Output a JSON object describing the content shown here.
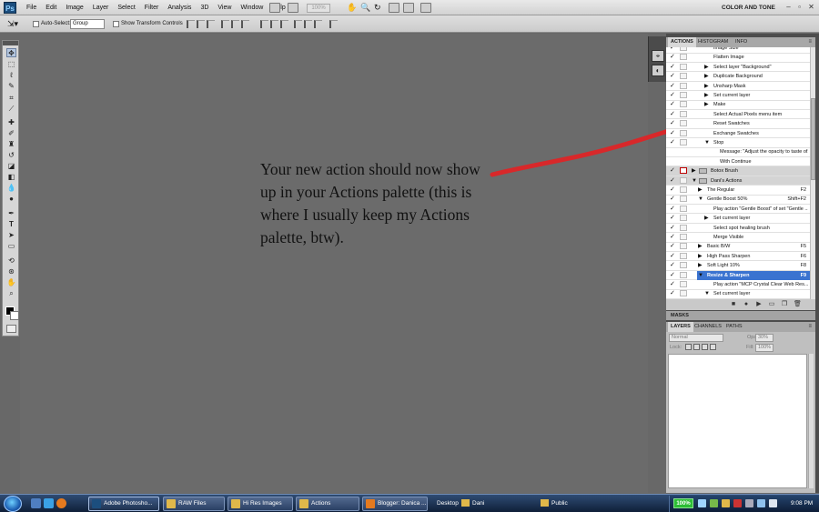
{
  "app": {
    "logo": "Ps",
    "workspace": "COLOR AND TONE",
    "zoom": "100%"
  },
  "menu": [
    "File",
    "Edit",
    "Image",
    "Layer",
    "Select",
    "Filter",
    "Analysis",
    "3D",
    "View",
    "Window",
    "Help"
  ],
  "options": {
    "auto_select_label": "Auto-Select:",
    "auto_select_value": "Group",
    "transform_label": "Show Transform Controls"
  },
  "caption": "Your new action should now show up in your Actions palette (this is where I usually keep my Actions palette, btw).",
  "panels": {
    "top_tabs": [
      "ACTIONS",
      "HISTOGRAM",
      "INFO"
    ],
    "masks_tab": "MASKS",
    "layers_tabs": [
      "LAYERS",
      "CHANNELS",
      "PATHS"
    ],
    "layers": {
      "blend_mode": "Normal",
      "opacity_label": "Opacity:",
      "opacity_value": "30%",
      "lock_label": "Lock:",
      "fill_label": "Fill:",
      "fill_value": "100%"
    }
  },
  "actions": [
    {
      "label": "Image Size",
      "indent": 3,
      "tri": "",
      "check": "✓",
      "dialog": "off",
      "key": ""
    },
    {
      "label": "Flatten Image",
      "indent": 3,
      "tri": "",
      "check": "✓",
      "dialog": "off",
      "key": ""
    },
    {
      "label": "Select layer \"Background\"",
      "indent": 3,
      "tri": "▶",
      "check": "✓",
      "dialog": "off",
      "key": ""
    },
    {
      "label": "Duplicate Background",
      "indent": 3,
      "tri": "▶",
      "check": "✓",
      "dialog": "off",
      "key": ""
    },
    {
      "label": "Unsharp Mask",
      "indent": 3,
      "tri": "▶",
      "check": "✓",
      "dialog": "off",
      "key": ""
    },
    {
      "label": "Set current layer",
      "indent": 3,
      "tri": "▶",
      "check": "✓",
      "dialog": "off",
      "key": ""
    },
    {
      "label": "Make",
      "indent": 3,
      "tri": "▶",
      "check": "✓",
      "dialog": "off",
      "key": ""
    },
    {
      "label": "Select Actual Pixels menu item",
      "indent": 3,
      "tri": "",
      "check": "✓",
      "dialog": "off",
      "key": ""
    },
    {
      "label": "Reset Swatches",
      "indent": 3,
      "tri": "",
      "check": "✓",
      "dialog": "off",
      "key": ""
    },
    {
      "label": "Exchange Swatches",
      "indent": 3,
      "tri": "",
      "check": "✓",
      "dialog": "off",
      "key": ""
    },
    {
      "label": "Stop",
      "indent": 3,
      "tri": "▼",
      "check": "✓",
      "dialog": "on",
      "key": ""
    },
    {
      "label": "Message:  \"Adjust the opacity to taste of...",
      "indent": 4,
      "tri": "",
      "check": "",
      "dialog": "none",
      "key": ""
    },
    {
      "label": "With Continue",
      "indent": 4,
      "tri": "",
      "check": "",
      "dialog": "none",
      "key": ""
    },
    {
      "label": "Botox Brush",
      "indent": 1,
      "tri": "▶",
      "check": "✓",
      "dialog": "red",
      "key": "",
      "folder": true
    },
    {
      "label": "Dani's Actions",
      "indent": 1,
      "tri": "▼",
      "check": "✓",
      "dialog": "off",
      "key": "",
      "folder": true
    },
    {
      "label": "The Regular",
      "indent": 2,
      "tri": "▶",
      "check": "✓",
      "dialog": "off",
      "key": "F2"
    },
    {
      "label": "Gentle Boost 50%",
      "indent": 2,
      "tri": "▼",
      "check": "✓",
      "dialog": "off",
      "key": "Shift+F2"
    },
    {
      "label": "Play action \"Gentle Boost\" of set \"Gentle ...",
      "indent": 3,
      "tri": "",
      "check": "✓",
      "dialog": "off",
      "key": ""
    },
    {
      "label": "Set current layer",
      "indent": 3,
      "tri": "▶",
      "check": "✓",
      "dialog": "off",
      "key": ""
    },
    {
      "label": "Select spot healing brush",
      "indent": 3,
      "tri": "",
      "check": "✓",
      "dialog": "off",
      "key": ""
    },
    {
      "label": "Merge Visible",
      "indent": 3,
      "tri": "",
      "check": "✓",
      "dialog": "off",
      "key": ""
    },
    {
      "label": "Basic B/W",
      "indent": 2,
      "tri": "▶",
      "check": "✓",
      "dialog": "off",
      "key": "F5"
    },
    {
      "label": "High Pass Sharpen",
      "indent": 2,
      "tri": "▶",
      "check": "✓",
      "dialog": "off",
      "key": "F6"
    },
    {
      "label": "Soft Light 10%",
      "indent": 2,
      "tri": "▶",
      "check": "✓",
      "dialog": "off",
      "key": "F8"
    },
    {
      "label": "Resize & Sharpen",
      "indent": 2,
      "tri": "▼",
      "check": "✓",
      "dialog": "off",
      "key": "F9",
      "selected": true
    },
    {
      "label": "Play action \"MCP Crystal Clear Web Res...",
      "indent": 3,
      "tri": "",
      "check": "✓",
      "dialog": "off",
      "key": ""
    },
    {
      "label": "Set current layer",
      "indent": 3,
      "tri": "▼",
      "check": "✓",
      "dialog": "off",
      "key": ""
    }
  ],
  "taskbar": {
    "buttons": [
      {
        "label": "Adobe Photosho...",
        "color": "#1c4e7e"
      },
      {
        "label": "RAW Files",
        "color": "#e0b84a"
      },
      {
        "label": "Hi Res Images",
        "color": "#e0b84a"
      },
      {
        "label": "Actions",
        "color": "#e0b84a"
      },
      {
        "label": "Blogger: Danica ...",
        "color": "#e57a1f"
      },
      {
        "label": "Desktop",
        "color": ""
      },
      {
        "label": "Dani",
        "color": "#e0b84a"
      },
      {
        "label": "Public",
        "color": "#e0b84a"
      }
    ],
    "battery": "100%",
    "time": "9:08 PM"
  },
  "colors": {
    "annotation_arrow": "#d8282a",
    "selection": "#3a73d0"
  }
}
